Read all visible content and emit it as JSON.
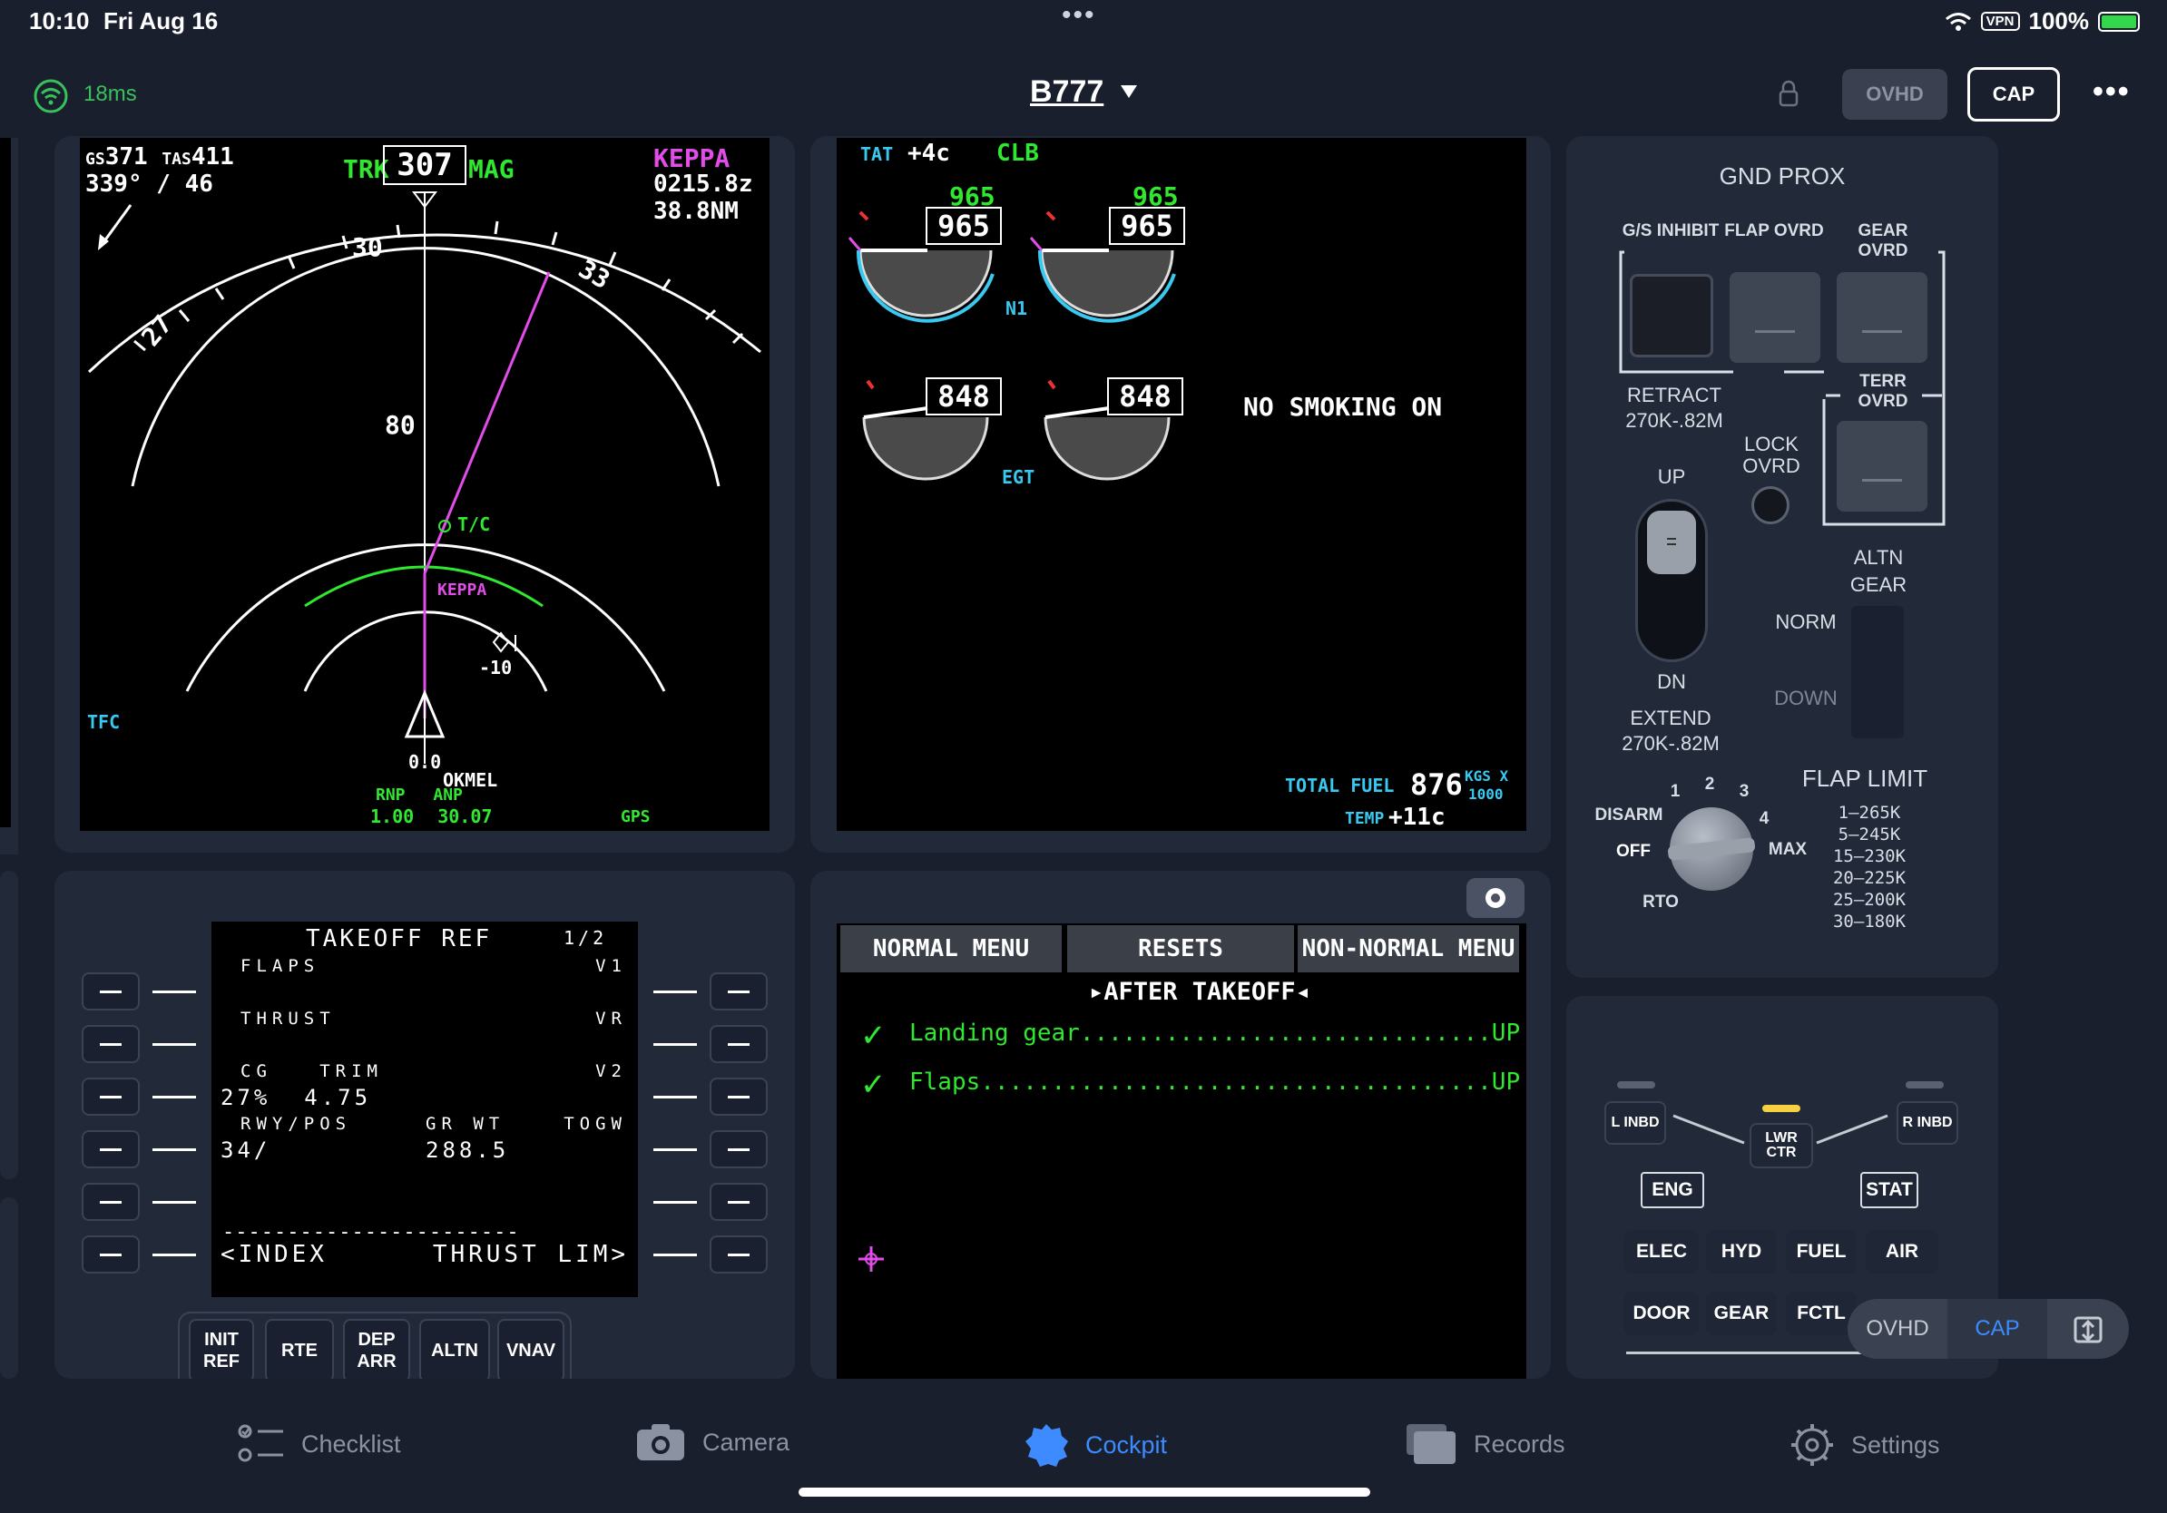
{
  "status_bar": {
    "time": "10:10",
    "date": "Fri Aug 16",
    "vpn": "VPN",
    "battery": "100%"
  },
  "top_bar": {
    "latency": "18ms",
    "aircraft": "B777",
    "ovhd_label": "OVHD",
    "cap_label": "CAP"
  },
  "nd": {
    "gs_label": "GS",
    "gs": "371",
    "tas_label": "TAS",
    "tas": "411",
    "wind": "339° / 46",
    "trk_label": "TRK",
    "trk": "307",
    "mag_label": "MAG",
    "waypoint": "KEPPA",
    "eta": "0215.8z",
    "dist": "38.8NM",
    "compass": [
      "30",
      "33",
      "27"
    ],
    "range_label": "80",
    "tc_label": "T/C",
    "wpt_label": "KEPPA",
    "traffic_alt": "-10",
    "tfc": "TFC",
    "bottom_00": "0.0",
    "bottom_wpt": "OKMEL",
    "rnp_label": "RNP",
    "anp_label": "ANP",
    "rnp": "1.00",
    "anp": "30.07",
    "gps": "GPS"
  },
  "eicas": {
    "tat_label": "TAT",
    "tat": "+4c",
    "mode": "CLB",
    "n1_left_target": "965",
    "n1_left": "965",
    "n1_right_target": "965",
    "n1_right": "965",
    "n1_label": "N1",
    "egt_left": "848",
    "egt_right": "848",
    "egt_label": "EGT",
    "message": "NO SMOKING ON",
    "total_fuel_label": "TOTAL FUEL",
    "total_fuel": "876",
    "fuel_unit_1": "KGS X",
    "fuel_unit_2": "1000",
    "temp_label": "TEMP",
    "temp": "+11c"
  },
  "cdu": {
    "title": "TAKEOFF REF",
    "page": "1/2",
    "l1_label": "FLAPS",
    "r1_label": "V1",
    "l2_label": "THRUST",
    "r2_label": "VR",
    "l3_label": "CG   TRIM",
    "r3_label": "V2",
    "l3_value": "27%  4.75",
    "l4_label": "RWY/POS",
    "m4_label": "GR WT",
    "r4_label": "TOGW",
    "l4_value": "34/",
    "m4_value": "288.5",
    "divider": "-----------------------",
    "l6": "<INDEX",
    "r6": "THRUST LIM>",
    "keys": [
      "INIT REF",
      "RTE",
      "DEP ARR",
      "ALTN",
      "VNAV"
    ]
  },
  "checklist": {
    "tabs": [
      "NORMAL MENU",
      "RESETS",
      "NON-NORMAL MENU"
    ],
    "title": "AFTER TAKEOFF",
    "items": [
      {
        "check": "✓",
        "text": "Landing gear.............................UP"
      },
      {
        "check": "✓",
        "text": "Flaps....................................UP"
      }
    ]
  },
  "gnd_prox": {
    "title": "GND PROX",
    "gs_inhibit": "G/S INHIBIT",
    "flap_ovrd": "FLAP OVRD",
    "gear_ovrd": "GEAR OVRD",
    "terr_ovrd": "TERR OVRD",
    "retract": "RETRACT",
    "retract_spd": "270K-.82M",
    "lock_ovrd": "LOCK OVRD",
    "up": "UP",
    "dn": "DN",
    "extend": "EXTEND",
    "extend_spd": "270K-.82M",
    "altn_gear": "ALTN GEAR",
    "norm": "NORM",
    "down": "DOWN",
    "flap_limit_title": "FLAP LIMIT",
    "flap_limits": [
      "1–265K",
      "5–245K",
      "15–230K",
      "20–225K",
      "25–200K",
      "30–180K"
    ],
    "knob": {
      "disarm": "DISARM",
      "off": "OFF",
      "rto": "RTO",
      "max": "MAX",
      "n1": "1",
      "n2": "2",
      "n3": "3",
      "n4": "4"
    }
  },
  "display_select": {
    "l_inbd": "L INBD",
    "lwr_ctr": "LWR CTR",
    "r_inbd": "R INBD",
    "eng": "ENG",
    "stat": "STAT",
    "row1": [
      "ELEC",
      "HYD",
      "FUEL",
      "AIR"
    ],
    "row2": [
      "DOOR",
      "GEAR",
      "FCTL"
    ]
  },
  "segment": {
    "ovhd": "OVHD",
    "cap": "CAP"
  },
  "tab_bar": [
    {
      "label": "Checklist",
      "icon": "checklist-icon"
    },
    {
      "label": "Camera",
      "icon": "camera-icon"
    },
    {
      "label": "Cockpit",
      "icon": "cockpit-icon"
    },
    {
      "label": "Records",
      "icon": "records-icon"
    },
    {
      "label": "Settings",
      "icon": "gear-icon"
    }
  ],
  "colors": {
    "accent": "#3d8bff",
    "green": "#2fe82f",
    "magenta": "#e24ce8",
    "cyan": "#38c8f0"
  }
}
